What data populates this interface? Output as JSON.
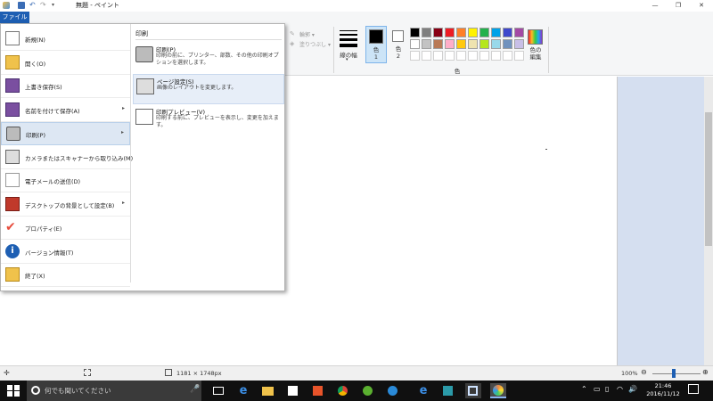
{
  "window": {
    "title": "無題 - ペイント"
  },
  "ribbon": {
    "file_tab": "ファイル",
    "outline_label": "輪郭 ▾",
    "fill_label": "塗りつぶし ▾",
    "size_label": "線の幅",
    "color1_label": "色\n1",
    "color2_label": "色\n2",
    "edit_colors_label": "色の\n編集",
    "colors_group_label": "色"
  },
  "palette": {
    "row1": [
      "#000000",
      "#7f7f7f",
      "#880015",
      "#ed1c24",
      "#ff7f27",
      "#fff200",
      "#22b14c",
      "#00a2e8",
      "#3f48cc",
      "#a349a4"
    ],
    "row2": [
      "#ffffff",
      "#c3c3c3",
      "#b97a57",
      "#ffaec9",
      "#ffc90e",
      "#efe4b0",
      "#b5e61d",
      "#99d9ea",
      "#7092be",
      "#c8bfe7"
    ],
    "row3": [
      "#ffffff",
      "#ffffff",
      "#ffffff",
      "#ffffff",
      "#ffffff",
      "#ffffff",
      "#ffffff",
      "#ffffff",
      "#ffffff",
      "#ffffff"
    ],
    "color1": "#000000",
    "color2": "#ffffff"
  },
  "file_menu": {
    "items": [
      {
        "label": "新規(N)",
        "icon": "new-file-icon",
        "arrow": ""
      },
      {
        "label": "開く(O)",
        "icon": "open-folder-icon",
        "arrow": ""
      },
      {
        "label": "上書き保存(S)",
        "icon": "save-icon",
        "arrow": ""
      },
      {
        "label": "名前を付けて保存(A)",
        "icon": "save-as-icon",
        "arrow": "▸"
      },
      {
        "label": "印刷(P)",
        "icon": "printer-icon",
        "arrow": "▸"
      },
      {
        "label": "カメラまたはスキャナーから取り込み(M)",
        "icon": "scanner-icon",
        "arrow": ""
      },
      {
        "label": "電子メールの送信(D)",
        "icon": "email-icon",
        "arrow": ""
      },
      {
        "label": "デスクトップの背景として設定(B)",
        "icon": "desktop-background-icon",
        "arrow": "▸"
      },
      {
        "label": "プロパティ(E)",
        "icon": "checkmark-icon",
        "arrow": ""
      },
      {
        "label": "バージョン情報(T)",
        "icon": "info-icon",
        "arrow": ""
      },
      {
        "label": "終了(X)",
        "icon": "exit-icon",
        "arrow": ""
      }
    ],
    "submenu": {
      "header": "印刷",
      "items": [
        {
          "title": "印刷(P)",
          "desc": "印刷の前に、プリンター、部数、その他の印刷オプションを選択します。",
          "icon": "printer-icon"
        },
        {
          "title": "ページ設定(S)",
          "desc": "画像のレイアウトを変更します。",
          "icon": "page-setup-icon"
        },
        {
          "title": "印刷プレビュー(V)",
          "desc": "印刷する前に、プレビューを表示し、変更を加えます。",
          "icon": "print-preview-icon"
        }
      ]
    }
  },
  "status": {
    "dimensions": "1181 × 1748px",
    "zoom": "100%"
  },
  "taskbar": {
    "search_placeholder": "何でも聞いてください",
    "time": "21:46",
    "date": "2016/11/12"
  }
}
